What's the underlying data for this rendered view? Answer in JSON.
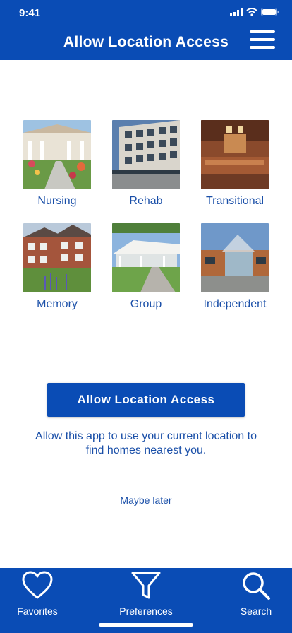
{
  "status": {
    "time": "9:41"
  },
  "header": {
    "title": "Allow Location Access"
  },
  "categories": [
    {
      "label": "Nursing"
    },
    {
      "label": "Rehab"
    },
    {
      "label": "Transitional"
    },
    {
      "label": "Memory"
    },
    {
      "label": "Group"
    },
    {
      "label": "Independent"
    }
  ],
  "cta": {
    "button_label": "Allow Location Access",
    "description": "Allow this app to use your current location to find homes nearest you.",
    "skip_label": "Maybe later"
  },
  "tabbar": {
    "items": [
      {
        "label": "Favorites",
        "icon": "heart-icon"
      },
      {
        "label": "Preferences",
        "icon": "filter-icon"
      },
      {
        "label": "Search",
        "icon": "search-icon"
      }
    ]
  },
  "colors": {
    "brand": "#0a4cb5",
    "text": "#1a4fa8",
    "background": "#ffffff"
  }
}
